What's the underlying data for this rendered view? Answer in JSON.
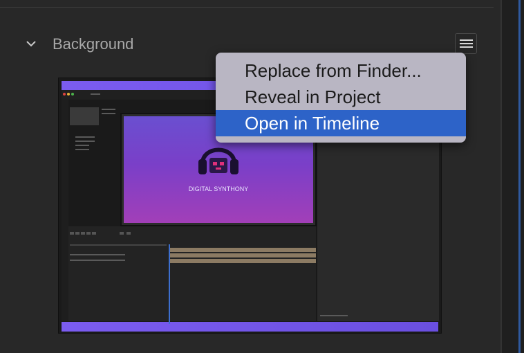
{
  "section": {
    "title": "Background",
    "expand_icon": "chevron-down-icon",
    "menu_icon": "hamburger-menu-icon"
  },
  "thumbnail": {
    "logo_text": "DIGITAL SYNTHONY"
  },
  "context_menu": {
    "items": [
      {
        "label": "Replace from Finder..."
      },
      {
        "label": "Reveal in Project"
      },
      {
        "label": "Open in Timeline",
        "selected": true
      }
    ],
    "selected_color": "#2d63c8"
  },
  "colors": {
    "accent": "#2d63c8",
    "thumbnail_bar": "#7b5cf0"
  }
}
